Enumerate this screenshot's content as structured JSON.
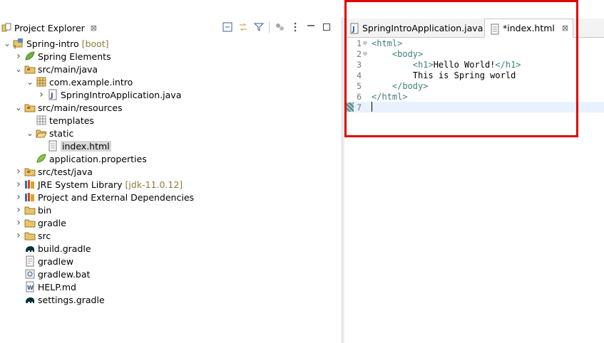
{
  "explorer": {
    "title": "Project Explorer",
    "close_glyph": "⊠",
    "toolbar_icons": [
      "collapse-all-icon",
      "link-with-editor-icon",
      "filter-icon",
      "focus-icon",
      "view-menu-icon",
      "minimize-icon",
      "maximize-icon"
    ],
    "tree": [
      {
        "label": "Spring-intro",
        "decoration": "[boot]",
        "depth": 0,
        "twisty": "open",
        "icon": "project-icon"
      },
      {
        "label": "Spring Elements",
        "decoration": "",
        "depth": 1,
        "twisty": "closed",
        "icon": "spring-leaf-icon"
      },
      {
        "label": "src/main/java",
        "decoration": "",
        "depth": 1,
        "twisty": "open",
        "icon": "source-folder-icon"
      },
      {
        "label": "com.example.intro",
        "decoration": "",
        "depth": 2,
        "twisty": "open",
        "icon": "package-icon"
      },
      {
        "label": "SpringIntroApplication.java",
        "decoration": "",
        "depth": 3,
        "twisty": "closed",
        "icon": "java-file-icon"
      },
      {
        "label": "src/main/resources",
        "decoration": "",
        "depth": 1,
        "twisty": "open",
        "icon": "source-folder-icon"
      },
      {
        "label": "templates",
        "decoration": "",
        "depth": 2,
        "twisty": "none",
        "icon": "package-empty-icon"
      },
      {
        "label": "static",
        "decoration": "",
        "depth": 2,
        "twisty": "open",
        "icon": "folder-open-icon"
      },
      {
        "label": "index.html",
        "decoration": "",
        "depth": 3,
        "twisty": "none",
        "icon": "html-file-icon",
        "selected": true
      },
      {
        "label": "application.properties",
        "decoration": "",
        "depth": 2,
        "twisty": "none",
        "icon": "properties-leaf-icon"
      },
      {
        "label": "src/test/java",
        "decoration": "",
        "depth": 1,
        "twisty": "closed",
        "icon": "source-folder-icon"
      },
      {
        "label": "JRE System Library",
        "decoration": "[jdk-11.0.12]",
        "depth": 1,
        "twisty": "closed",
        "icon": "library-icon"
      },
      {
        "label": "Project and External Dependencies",
        "decoration": "",
        "depth": 1,
        "twisty": "closed",
        "icon": "library-icon"
      },
      {
        "label": "bin",
        "decoration": "",
        "depth": 1,
        "twisty": "closed",
        "icon": "folder-icon"
      },
      {
        "label": "gradle",
        "decoration": "",
        "depth": 1,
        "twisty": "closed",
        "icon": "folder-icon"
      },
      {
        "label": "src",
        "decoration": "",
        "depth": 1,
        "twisty": "closed",
        "icon": "folder-icon"
      },
      {
        "label": "build.gradle",
        "decoration": "",
        "depth": 1,
        "twisty": "none",
        "icon": "gradle-elephant-icon"
      },
      {
        "label": "gradlew",
        "decoration": "",
        "depth": 1,
        "twisty": "none",
        "icon": "text-file-icon"
      },
      {
        "label": "gradlew.bat",
        "decoration": "",
        "depth": 1,
        "twisty": "none",
        "icon": "bat-file-icon"
      },
      {
        "label": "HELP.md",
        "decoration": "",
        "depth": 1,
        "twisty": "none",
        "icon": "word-file-icon"
      },
      {
        "label": "settings.gradle",
        "decoration": "",
        "depth": 1,
        "twisty": "none",
        "icon": "gradle-elephant-icon"
      }
    ]
  },
  "editor": {
    "tabs": [
      {
        "label": "SpringIntroApplication.java",
        "icon": "java-file-icon",
        "active": false
      },
      {
        "label": "*index.html",
        "icon": "html-file-icon",
        "active": true
      }
    ],
    "close_glyph": "⊠",
    "lines": [
      {
        "n": "1",
        "fold": "⊖",
        "src": "<html>"
      },
      {
        "n": "2",
        "fold": "⊖",
        "src": "    <body>"
      },
      {
        "n": "3",
        "fold": "",
        "src": "        <h1>Hello World!</h1>"
      },
      {
        "n": "4",
        "fold": "",
        "src": "        This is Spring world"
      },
      {
        "n": "5",
        "fold": "",
        "src": "    </body>"
      },
      {
        "n": "6",
        "fold": "",
        "src": "</html>"
      },
      {
        "n": "7",
        "fold": "",
        "src": ""
      }
    ],
    "current_line": 7
  },
  "colors": {
    "tag": "#3f7f7f",
    "highlight_box": "#e00000",
    "current_line_bg": "#e8f2fe"
  }
}
